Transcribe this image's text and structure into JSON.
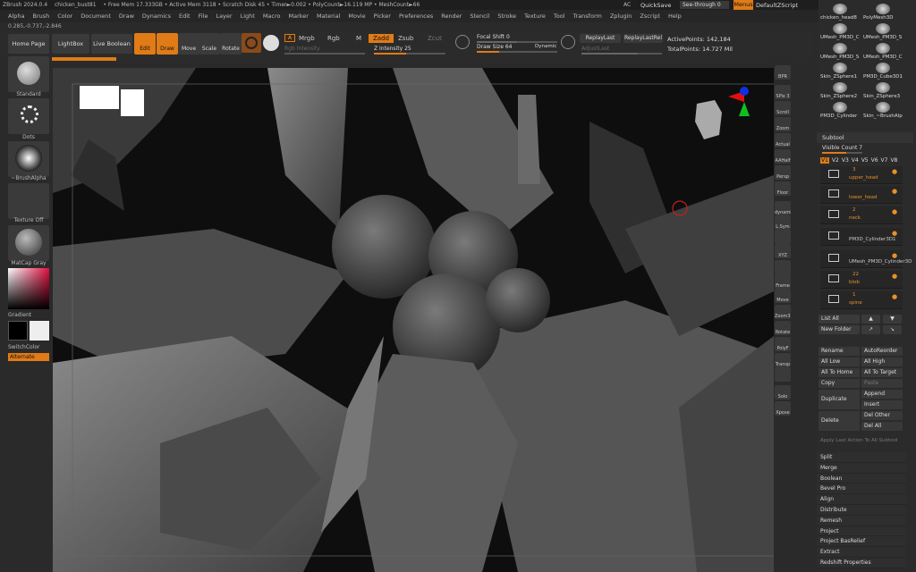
{
  "titlebar": {
    "items": [
      "ZBrush 2024.0.4",
      "chicken_bust81",
      "• Free Mem 17.333GB • Active Mem 3118 • Scratch Disk 45 • Timer►0.002 • PolyCount►16.119 MP • MeshCount►66"
    ],
    "ac": "AC",
    "quicksave": "QuickSave",
    "see_through_label": "See-through",
    "see_through_value": "0",
    "menus_label": "Menus",
    "script_label": "DefaultZScript"
  },
  "menubar": [
    "Alpha",
    "Brush",
    "Color",
    "Document",
    "Draw",
    "Dynamics",
    "Edit",
    "File",
    "Layer",
    "Light",
    "Macro",
    "Marker",
    "Material",
    "Movie",
    "Picker",
    "Preferences",
    "Render",
    "Stencil",
    "Stroke",
    "Texture",
    "Tool",
    "Transform",
    "Zplugin",
    "Zscript",
    "Help"
  ],
  "coords": "0.285,-0.737,-2.846",
  "toolbar": {
    "home_page": "Home Page",
    "lightbox": "LightBox",
    "live_boolean": "Live Boolean",
    "edit": "Edit",
    "draw": "Draw",
    "move": "Move",
    "scale": "Scale",
    "rotate": "Rotate",
    "a": "A",
    "mrgb": "Mrgb",
    "rgb": "Rgb",
    "m": "M",
    "zadd": "Zadd",
    "zsub": "Zsub",
    "zcut": "Zcut",
    "rgb_intensity": "Rgb Intensity",
    "z_intensity": "Z Intensity",
    "z_intensity_value": "25",
    "focal_shift": "Focal Shift",
    "focal_shift_value": "0",
    "draw_size": "Draw Size",
    "draw_size_value": "64",
    "dynamic": "Dynamic",
    "replay_last": "ReplayLast",
    "replay_last_rel": "ReplayLastRel",
    "adjust_last": "AdjustLast",
    "active_points": "ActivePoints: 142,184",
    "total_points": "TotalPoints: 14.727 Mil"
  },
  "left": {
    "standard": "Standard",
    "dots": "Dots",
    "brush_alpha": "~BrushAlpha",
    "texture_off": "Texture Off",
    "matcap": "MatCap Gray",
    "gradient": "Gradient",
    "switch_color": "SwitchColor",
    "alternate": "Alternate"
  },
  "vbar": [
    "BPR",
    "SPix 3",
    "Scroll",
    "Zoom",
    "Actual",
    "AAHalf",
    "Persp",
    "Floor",
    "dynamic",
    "L.Sym",
    "",
    "XYZ",
    "",
    "Frame",
    "Move",
    "Zoom3D",
    "Rotate",
    "PolyF",
    "Transp",
    "",
    "Solo",
    "Xpose"
  ],
  "tools": [
    [
      "chicken_head8",
      "PolyMesh3D"
    ],
    [
      "UMesh_PM3D_C",
      "UMesh_PM3D_S"
    ],
    [
      "UMesh_PM3D_S",
      "UMesh_PM3D_C"
    ],
    [
      "Skin_ZSphere1",
      "PM3D_Cube3D1"
    ],
    [
      "Skin_ZSphere2",
      "Skin_ZSphere3"
    ],
    [
      "PM3D_Cylinder",
      "Skin_~BrushAlp"
    ]
  ],
  "subtool": {
    "header": "Subtool",
    "visible_count_label": "Visible Count",
    "visible_count": "7",
    "tabs": [
      "V1",
      "V2",
      "V3",
      "V4",
      "V5",
      "V6",
      "V7",
      "V8"
    ],
    "rows": [
      {
        "num": "3",
        "name": "upper_head"
      },
      {
        "num": "",
        "name": "lower_head"
      },
      {
        "num": "2",
        "name": "neck"
      },
      {
        "num": "",
        "name": "PM3D_Cylinder3D1"
      },
      {
        "num": "",
        "name": "UMesh_PM3D_Cylinder3D"
      },
      {
        "num": "22",
        "name": "blob"
      },
      {
        "num": "1",
        "name": "spine"
      }
    ],
    "list_all": "List All",
    "new_folder": "New Folder",
    "rename": "Rename",
    "auto_reorder": "AutoReorder",
    "all_low": "All Low",
    "all_high": "All High",
    "all_to_home": "All To Home",
    "all_to_target": "All To Target",
    "copy": "Copy",
    "paste": "Paste",
    "append": "Append",
    "duplicate": "Duplicate",
    "insert": "Insert",
    "delete": "Delete",
    "del_other": "Del Other",
    "del_all": "Del All",
    "apply_last": "Apply Last Action To All Subtool",
    "actions": [
      "Split",
      "Merge",
      "Boolean",
      "Bevel Pro",
      "Align",
      "Distribute",
      "Remesh",
      "Project",
      "Project BasRelief",
      "Extract",
      "Redshift Properties"
    ]
  }
}
